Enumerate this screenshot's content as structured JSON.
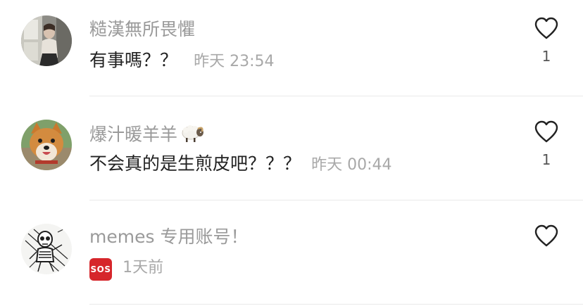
{
  "comments": [
    {
      "username": "糙漢無所畏懼",
      "text": "有事嗎？？",
      "time": "昨天 23:54",
      "likes": "1",
      "avatar": "avatar-person-window"
    },
    {
      "username": "爆汁暖羊羊",
      "text": "不会真的是生煎皮吧？？？",
      "time": "昨天 00:44",
      "likes": "1",
      "avatar": "avatar-shiba-dog",
      "username_emoji": "sheep-icon"
    },
    {
      "username": "memes 专用账号！",
      "badge": "SOS",
      "time": "1天前",
      "likes": "",
      "avatar": "avatar-skeleton-sketch"
    }
  ],
  "icons": {
    "like": "heart-outline-icon"
  },
  "colors": {
    "username": "#9a9a9a",
    "text": "#222222",
    "time": "#a8a8a8",
    "sos_badge": "#d6262b",
    "divider": "#e9e9e9"
  }
}
